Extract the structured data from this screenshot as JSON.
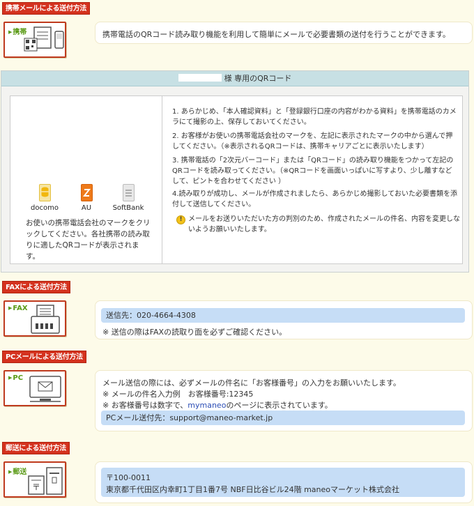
{
  "sections": {
    "mobile": {
      "header": "携帯メールによる送付方法",
      "icon_tag": "携帯",
      "description": "携帯電話のQRコード読み取り機能を利用して簡単にメールで必要書類の送付を行うことができます。"
    },
    "qr": {
      "title_suffix": "様 専用のQRコード",
      "carriers": [
        {
          "name": "docomo",
          "icon": "docomo-icon"
        },
        {
          "name": "AU",
          "icon": "au-icon"
        },
        {
          "name": "SoftBank",
          "icon": "softbank-icon"
        }
      ],
      "left_note": "お使いの携帯電話会社のマークをクリックしてください。各社携帯の読み取りに適したQRコードが表示されます。",
      "steps": [
        "1. あらかじめ、「本人確認資料」と「登録銀行口座の内容がわかる資料」を携帯電話のカメラにて撮影の上、保存しておいてください。",
        "2. お客様がお使いの携帯電話会社のマークを、左記に表示されたマークの中から選んで押してください。（※表示されるQRコードは、携帯キャリアごとに表示いたします）",
        "3. 携帯電話の「2次元バーコード」または「QRコード」の読み取り機能をつかって左記のQRコードを読み取ってください。（※QRコードを画面いっぱいに写すより、少し離すなどして、ピントを合わせてください ）",
        "4.読み取りが成功し、メールが作成されましたら、あらかじめ撮影しておいた必要書類を添付して送信してください。"
      ],
      "warning": "メールをお送りいただいた方の判別のため、作成されたメールの件名、内容を変更しないようお願いいたします。"
    },
    "fax": {
      "header": "FAXによる送付方法",
      "icon_tag": "FAX",
      "number_line": "送信先：020-4664-4308",
      "note": "※ 送信の際はFAXの読取り面を必ずご確認ください。"
    },
    "pc": {
      "header": "PCメールによる送付方法",
      "icon_tag": "PC",
      "line1": "メール送信の際には、必ずメールの件名に「お客様番号」の入力をお願いいたします。",
      "line2": "※ メールの件名入力例　お客様番号:12345",
      "line3_prefix": "※ お客様番号は数字で、",
      "line3_link": "mymaneo",
      "line3_suffix": "のページに表示されています。",
      "email_line": "PCメール送付先：support@maneo-market.jp"
    },
    "post": {
      "header": "郵送による送付方法",
      "icon_tag": "郵送",
      "zip": "〒100-0011",
      "address": "東京都千代田区内幸町1丁目1番7号 NBF日比谷ビル24階 maneoマーケット株式会社"
    }
  },
  "colors": {
    "header_red": "#d4321e",
    "tag_green": "#5a9a16",
    "highlight_blue": "#c6ddf6",
    "qr_header": "#c7e0e4",
    "page_bg": "#fdfbe9"
  }
}
